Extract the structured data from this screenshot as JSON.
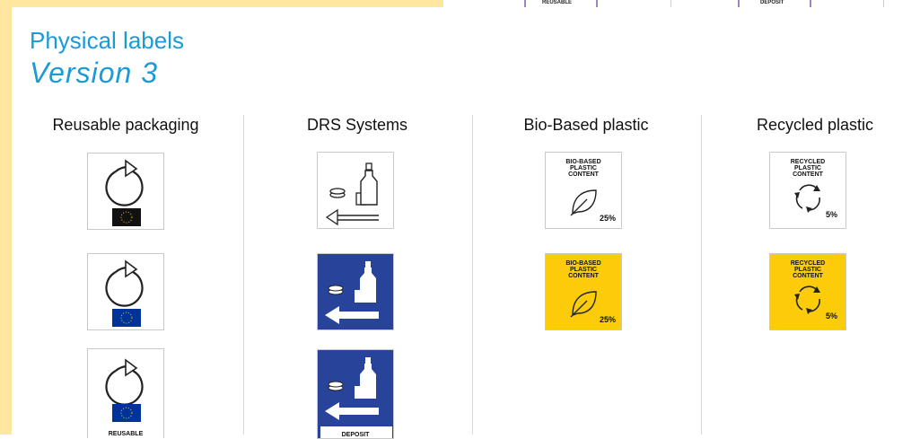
{
  "header": {
    "title": "Physical labels",
    "subtitle": "Version 3"
  },
  "peek": {
    "left_text": "REUSABLE",
    "right_text": "DEPOSIT"
  },
  "columns": [
    {
      "heading": "Reusable packaging"
    },
    {
      "heading": "DRS Systems"
    },
    {
      "heading": "Bio-Based plastic"
    },
    {
      "heading": "Recycled plastic"
    }
  ],
  "labels": {
    "reusable_bottom_caption": "REUSABLE",
    "drs_bottom_caption": "DEPOSIT",
    "bio": {
      "caption_line1": "BIO-BASED",
      "caption_line2": "PLASTIC",
      "caption_line3": "CONTENT",
      "percent": "25%"
    },
    "recycled": {
      "caption_line1": "RECYCLED",
      "caption_line2": "PLASTIC",
      "caption_line3": "CONTENT",
      "percent": "5%"
    }
  },
  "colors": {
    "title_blue": "#1a9ad6",
    "drs_blue": "#28449a",
    "label_yellow": "#fccc0a",
    "eu_blue": "#003399",
    "eu_star": "#ffcc00",
    "peek_purple": "#a084c6",
    "side_yellow": "#ffe7a0"
  }
}
